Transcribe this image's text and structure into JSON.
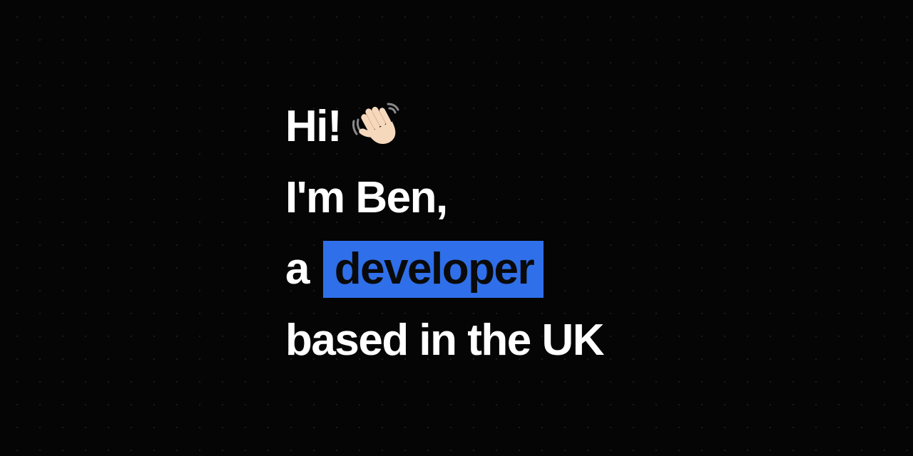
{
  "greeting": {
    "text": "Hi!",
    "icon": "waving-hand-icon"
  },
  "intro_line": "I'm Ben,",
  "role_prefix": "a",
  "role": "developer",
  "location_line": "based in the UK",
  "colors": {
    "background": "#050505",
    "text": "#ffffff",
    "highlight": "#2f6fea",
    "highlight_text": "#0a0a0a"
  }
}
